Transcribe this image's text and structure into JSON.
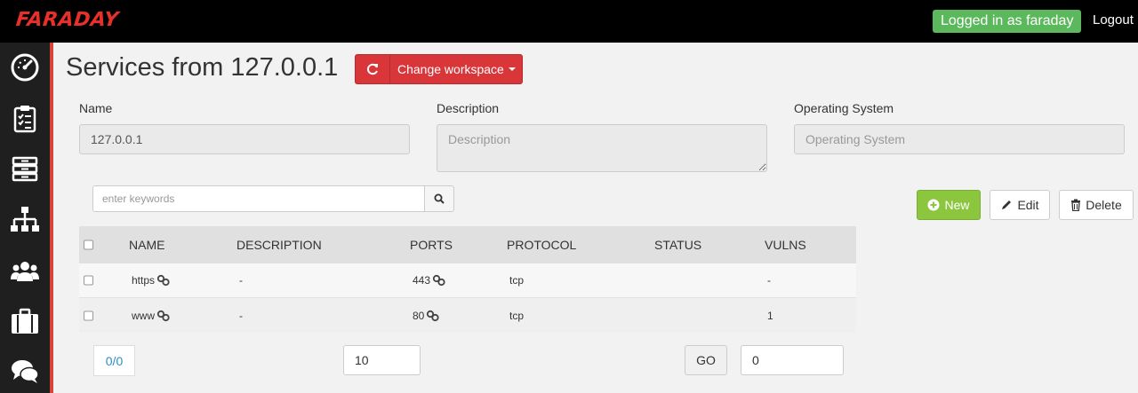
{
  "header": {
    "logo": "FARADAY",
    "logged_in_text": "Logged in as faraday",
    "logout_label": "Logout"
  },
  "sidebar": {
    "items": [
      {
        "icon": "dashboard-gauge-icon"
      },
      {
        "icon": "clipboard-checklist-icon"
      },
      {
        "icon": "inbox-tray-icon"
      },
      {
        "icon": "sitemap-hierarchy-icon"
      },
      {
        "icon": "users-group-icon"
      },
      {
        "icon": "briefcase-icon"
      },
      {
        "icon": "chat-bubbles-icon"
      }
    ]
  },
  "page": {
    "title": "Services from 127.0.0.1",
    "workspace_button_label": "Change workspace"
  },
  "host_fields": {
    "name_label": "Name",
    "name_value": "127.0.0.1",
    "description_label": "Description",
    "description_placeholder": "Description",
    "os_label": "Operating System",
    "os_placeholder": "Operating System"
  },
  "search": {
    "placeholder": "enter keywords"
  },
  "actions": {
    "new_label": "New",
    "edit_label": "Edit",
    "delete_label": "Delete"
  },
  "table": {
    "columns": [
      "NAME",
      "DESCRIPTION",
      "PORTS",
      "PROTOCOL",
      "STATUS",
      "VULNS"
    ],
    "rows": [
      {
        "name": "https",
        "description": "-",
        "port": "443",
        "protocol": "tcp",
        "status": "",
        "vulns": "-"
      },
      {
        "name": "www",
        "description": "-",
        "port": "80",
        "protocol": "tcp",
        "status": "",
        "vulns": "1"
      }
    ]
  },
  "pagination": {
    "count": "0/0",
    "page_size": "10",
    "go_label": "GO",
    "go_page": "0"
  },
  "colors": {
    "brand_red": "#e8302b",
    "workspace_button": "#d9363a",
    "logged_in_badge": "#5cb85c",
    "new_button": "#8cc63f",
    "link_blue": "#2a8fcb"
  }
}
